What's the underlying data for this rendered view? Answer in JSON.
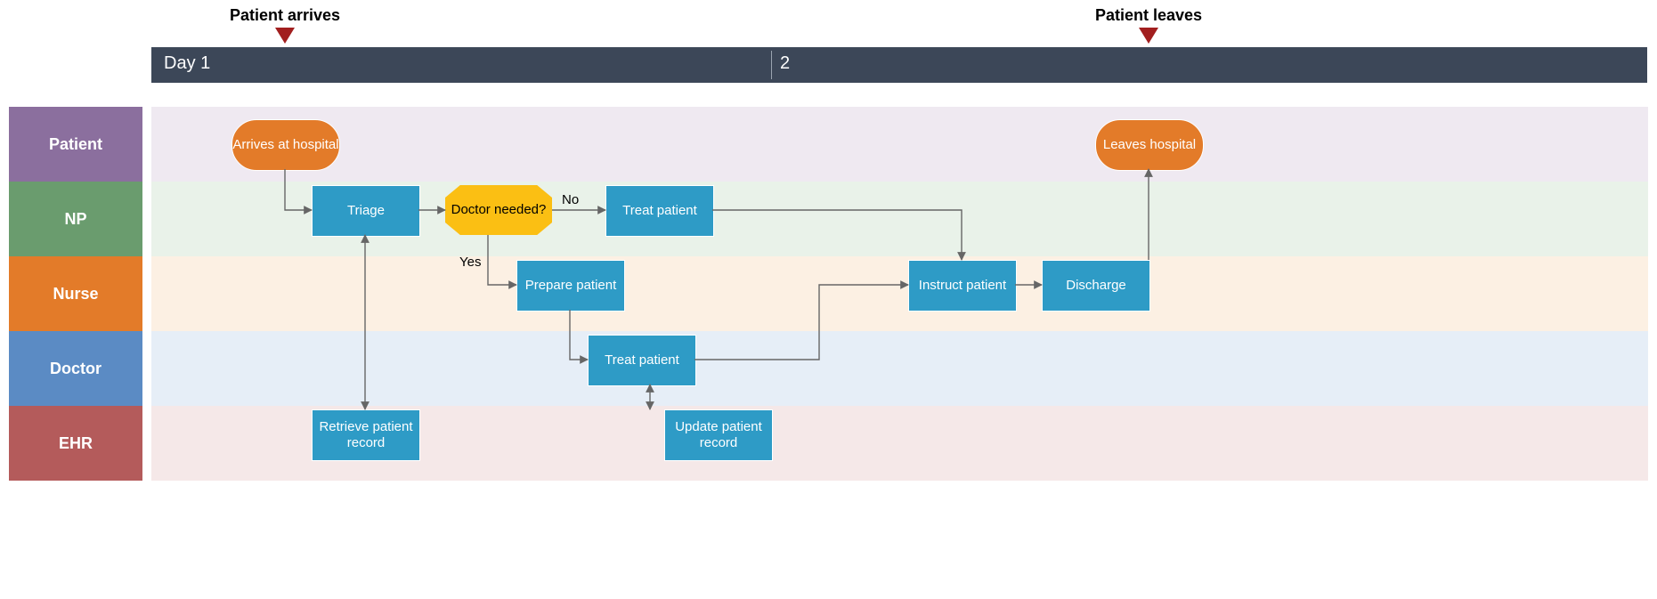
{
  "timeline": {
    "markers": [
      {
        "label": "Patient arrives"
      },
      {
        "label": "Patient leaves"
      }
    ],
    "days": [
      {
        "label": "Day 1"
      },
      {
        "label": "2"
      }
    ]
  },
  "lanes": [
    {
      "key": "patient",
      "label": "Patient",
      "color": "#8b6f9e",
      "band": "#efe9f1"
    },
    {
      "key": "np",
      "label": "NP",
      "color": "#6a9c6e",
      "band": "#e9f2e9"
    },
    {
      "key": "nurse",
      "label": "Nurse",
      "color": "#e37b29",
      "band": "#fcf0e3"
    },
    {
      "key": "doctor",
      "label": "Doctor",
      "color": "#5b8bc4",
      "band": "#e6eef7"
    },
    {
      "key": "ehr",
      "label": "EHR",
      "color": "#b45b5b",
      "band": "#f5e8e8"
    }
  ],
  "shapes": {
    "arrives": {
      "label": "Arrives at hospital"
    },
    "triage": {
      "label": "Triage"
    },
    "decision": {
      "label": "Doctor needed?"
    },
    "treat_np": {
      "label": "Treat patient"
    },
    "prepare": {
      "label": "Prepare patient"
    },
    "treat_doc": {
      "label": "Treat patient"
    },
    "retrieve": {
      "label": "Retrieve patient record"
    },
    "update": {
      "label": "Update patient record"
    },
    "instruct": {
      "label": "Instruct patient"
    },
    "discharge": {
      "label": "Discharge"
    },
    "leaves": {
      "label": "Leaves hospital"
    }
  },
  "edges": {
    "no": "No",
    "yes": "Yes"
  }
}
